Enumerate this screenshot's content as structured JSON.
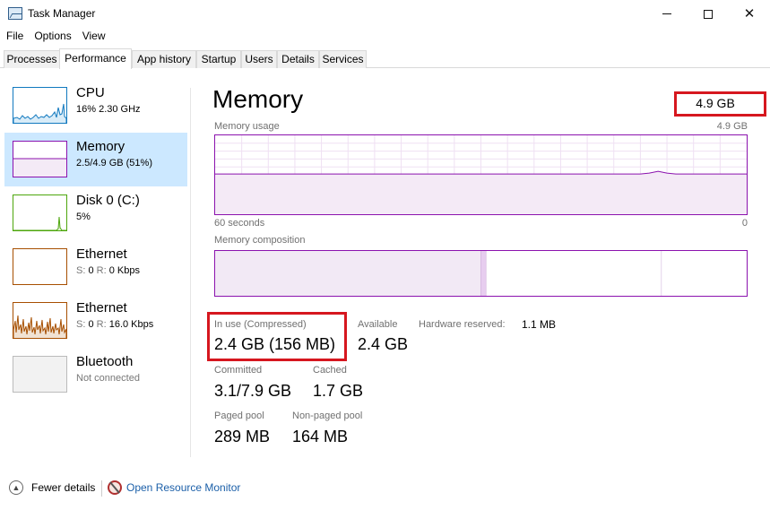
{
  "window": {
    "title": "Task Manager"
  },
  "menu": [
    "File",
    "Options",
    "View"
  ],
  "tabs": [
    "Processes",
    "Performance",
    "App history",
    "Startup",
    "Users",
    "Details",
    "Services"
  ],
  "active_tab": "Performance",
  "sidebar": {
    "items": [
      {
        "name": "CPU",
        "sub": "16%  2.30 GHz",
        "color": "#1179bf"
      },
      {
        "name": "Memory",
        "sub": "2.5/4.9 GB (51%)",
        "color": "#8b12ae",
        "selected": true
      },
      {
        "name": "Disk 0 (C:)",
        "sub": "5%",
        "color": "#4da60c"
      },
      {
        "name": "Ethernet",
        "sub_label": "S:",
        "sub_s": "0",
        "sub_mid": "R:",
        "sub_r": "0 Kbps",
        "color": "#a74f01"
      },
      {
        "name": "Ethernet",
        "sub_label": "S:",
        "sub_s": "0",
        "sub_mid": "R:",
        "sub_r": "16.0 Kbps",
        "color": "#a74f01"
      },
      {
        "name": "Bluetooth",
        "sub": "Not connected",
        "color": "#bbbbbb"
      }
    ]
  },
  "main": {
    "title": "Memory",
    "total": "4.9 GB",
    "usage_label": "Memory usage",
    "usage_max": "4.9 GB",
    "time_left": "60 seconds",
    "time_right": "0",
    "usage_level": 0.51,
    "composition_label": "Memory composition",
    "composition": {
      "in_use": 0.5,
      "modified": 0.01,
      "standby": 0.33,
      "free": 0.16
    },
    "stats": {
      "in_use_label": "In use (Compressed)",
      "in_use_value": "2.4 GB (156 MB)",
      "available_label": "Available",
      "available_value": "2.4 GB",
      "hw_reserved_label": "Hardware reserved:",
      "hw_reserved_value": "1.1 MB",
      "committed_label": "Committed",
      "committed_value": "3.1/7.9 GB",
      "cached_label": "Cached",
      "cached_value": "1.7 GB",
      "paged_label": "Paged pool",
      "paged_value": "289 MB",
      "nonpaged_label": "Non-paged pool",
      "nonpaged_value": "164 MB"
    }
  },
  "footer": {
    "fewer_details": "Fewer details",
    "resource_monitor": "Open Resource Monitor"
  },
  "colors": {
    "memory": "#8b12ae",
    "highlight": "#d6171f",
    "selected_bg": "#cce8ff"
  }
}
